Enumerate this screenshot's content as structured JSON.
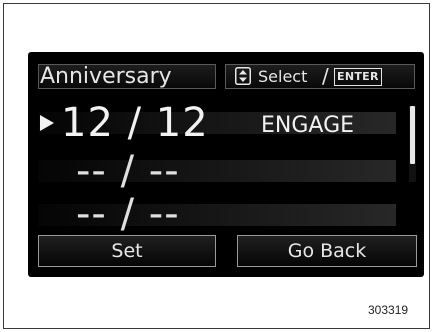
{
  "screen": {
    "title": "Anniversary",
    "hint": {
      "select_label": "Select",
      "separator": "/",
      "enter_key": "ENTER",
      "icon": "updown-arrows-icon"
    },
    "rows": [
      {
        "date": "12 / 12",
        "label": "ENGAGE",
        "selected": true
      },
      {
        "date": "-- / --",
        "label": "",
        "selected": false
      },
      {
        "date": "-- / --",
        "label": "",
        "selected": false
      }
    ],
    "buttons": {
      "set": "Set",
      "back": "Go Back"
    },
    "scrollbar": {
      "visible_fraction": 0.76
    }
  },
  "figure_number": "303319",
  "colors": {
    "screen_bg": "#000000",
    "text": "#e6e6e6",
    "border": "#9a9a9a"
  }
}
